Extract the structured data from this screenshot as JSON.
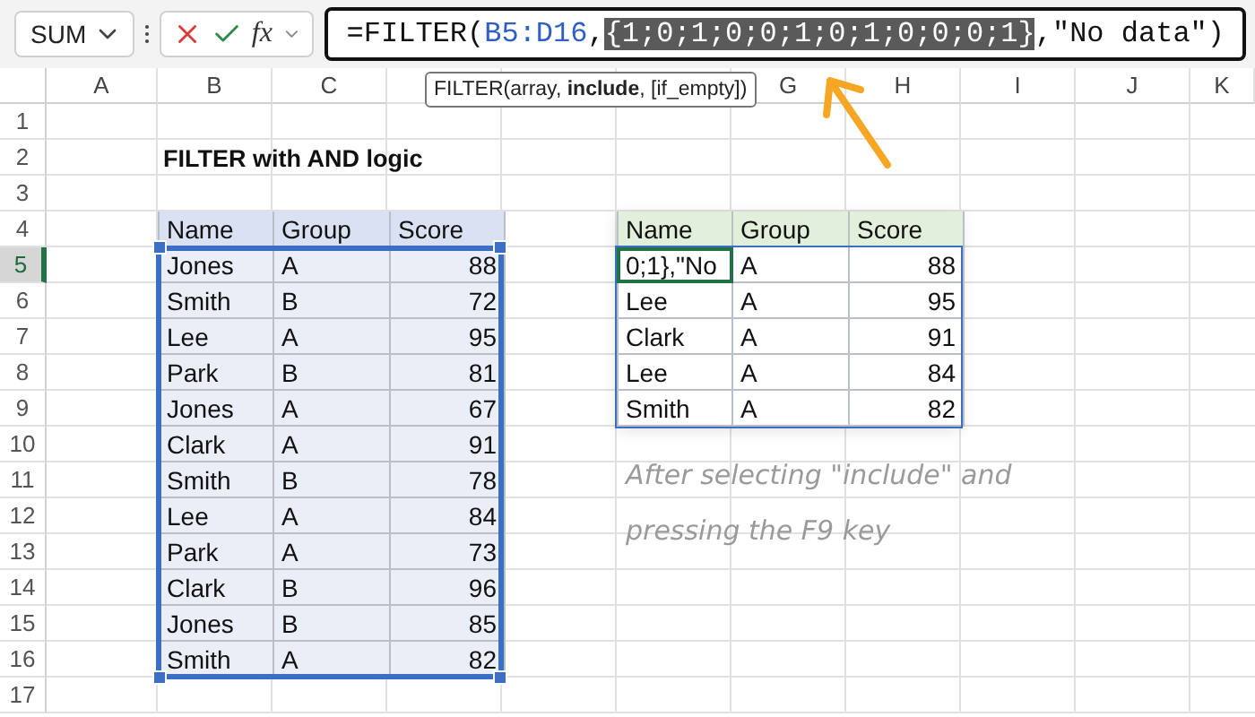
{
  "name_box": {
    "value": "SUM"
  },
  "function_button": "fx",
  "formula_bar": {
    "segments": [
      {
        "kind": "plain",
        "text": "=FILTER("
      },
      {
        "kind": "reference",
        "text": "B5:D16"
      },
      {
        "kind": "plain",
        "text": ","
      },
      {
        "kind": "selected",
        "text": "{1;0;1;0;0;1;0;1;0;0;0;1}"
      },
      {
        "kind": "plain",
        "text": ",\"No data\")"
      }
    ]
  },
  "tooltip": "FILTER(array, **include**, [if_empty])",
  "columns_left": [
    "A",
    "B",
    "C"
  ],
  "columns_right": [
    "G",
    "H",
    "I",
    "J",
    "K"
  ],
  "rows": [
    {
      "label": "1",
      "selected": false
    },
    {
      "label": "2",
      "selected": false
    },
    {
      "label": "3",
      "selected": false
    },
    {
      "label": "4",
      "selected": false
    },
    {
      "label": "5",
      "selected": true
    },
    {
      "label": "6",
      "selected": false
    },
    {
      "label": "7",
      "selected": false
    },
    {
      "label": "8",
      "selected": false
    },
    {
      "label": "9",
      "selected": false
    },
    {
      "label": "10",
      "selected": false
    },
    {
      "label": "11",
      "selected": false
    },
    {
      "label": "12",
      "selected": false
    },
    {
      "label": "13",
      "selected": false
    },
    {
      "label": "14",
      "selected": false
    },
    {
      "label": "15",
      "selected": false
    },
    {
      "label": "16",
      "selected": false
    },
    {
      "label": "17",
      "selected": false
    }
  ],
  "title": "FILTER with AND logic",
  "source_table": {
    "columns": [
      "Name",
      "Group",
      "Score"
    ],
    "rows": [
      {
        "name": "Jones",
        "group": "A",
        "score": "88"
      },
      {
        "name": "Smith",
        "group": "B",
        "score": "72"
      },
      {
        "name": "Lee",
        "group": "A",
        "score": "95"
      },
      {
        "name": "Park",
        "group": "B",
        "score": "81"
      },
      {
        "name": "Jones",
        "group": "A",
        "score": "67"
      },
      {
        "name": "Clark",
        "group": "A",
        "score": "91"
      },
      {
        "name": "Smith",
        "group": "B",
        "score": "78"
      },
      {
        "name": "Lee",
        "group": "A",
        "score": "84"
      },
      {
        "name": "Park",
        "group": "A",
        "score": "73"
      },
      {
        "name": "Clark",
        "group": "B",
        "score": "96"
      },
      {
        "name": "Jones",
        "group": "B",
        "score": "85"
      },
      {
        "name": "Smith",
        "group": "A",
        "score": "82"
      }
    ]
  },
  "result_table": {
    "columns": [
      "Name",
      "Group",
      "Score"
    ],
    "rows": [
      {
        "name": "0;1},\"No",
        "group": "A",
        "score": "88",
        "active": true
      },
      {
        "name": "Lee",
        "group": "A",
        "score": "95",
        "active": false
      },
      {
        "name": "Clark",
        "group": "A",
        "score": "91",
        "active": false
      },
      {
        "name": "Lee",
        "group": "A",
        "score": "84",
        "active": false
      },
      {
        "name": "Smith",
        "group": "A",
        "score": "82",
        "active": false
      }
    ]
  },
  "note": "After selecting \"include\" and pressing the F9 key"
}
